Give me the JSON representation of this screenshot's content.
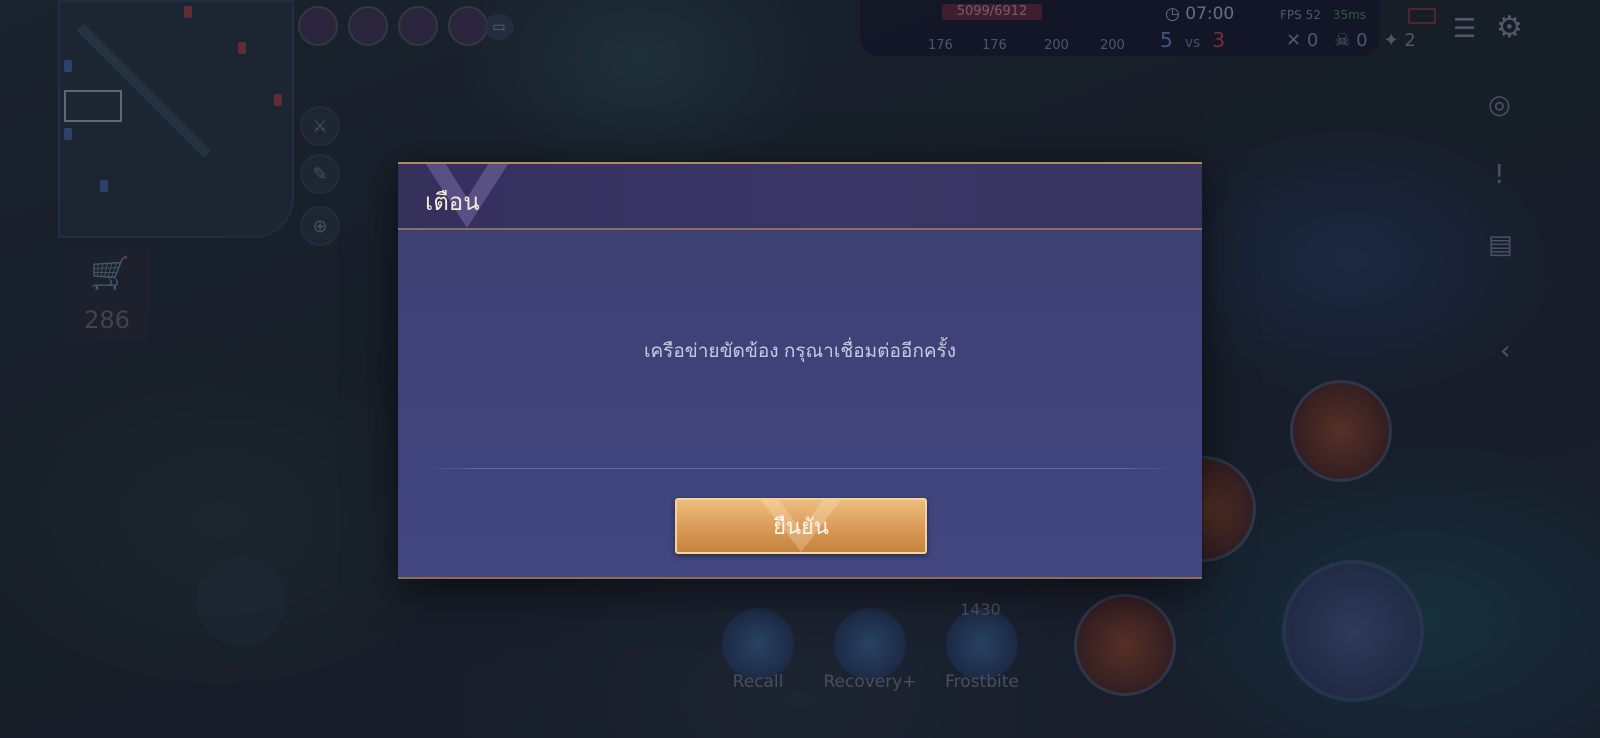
{
  "hud": {
    "gold": "286",
    "hp": "5099/6912",
    "timer": "07:00",
    "score_blue": "5",
    "score_vs": "vs",
    "score_red": "3",
    "stat_1": "176",
    "stat_2": "176",
    "stat_3": "200",
    "stat_4": "200",
    "fps": "FPS 52",
    "ping": "35ms",
    "kills": "0",
    "deaths": "0",
    "assists": "2",
    "cooldown": "1430"
  },
  "skills": [
    {
      "label": "Recall"
    },
    {
      "label": "Recovery+"
    },
    {
      "label": "Frostbite"
    }
  ],
  "dialog": {
    "title": "เตือน",
    "message": "เครือข่ายขัดข้อง กรุณาเชื่อมต่ออีกครั้ง",
    "confirm_label": "ยืนยัน"
  },
  "colors": {
    "dialog_bg": "#3f4277",
    "button_gold": "#d99a57",
    "title_text": "#f3ead6"
  },
  "icons": [
    "shopping-cart-icon",
    "clock-icon",
    "gear-icon",
    "menu-icon",
    "chat-icon",
    "zoom-icon"
  ]
}
